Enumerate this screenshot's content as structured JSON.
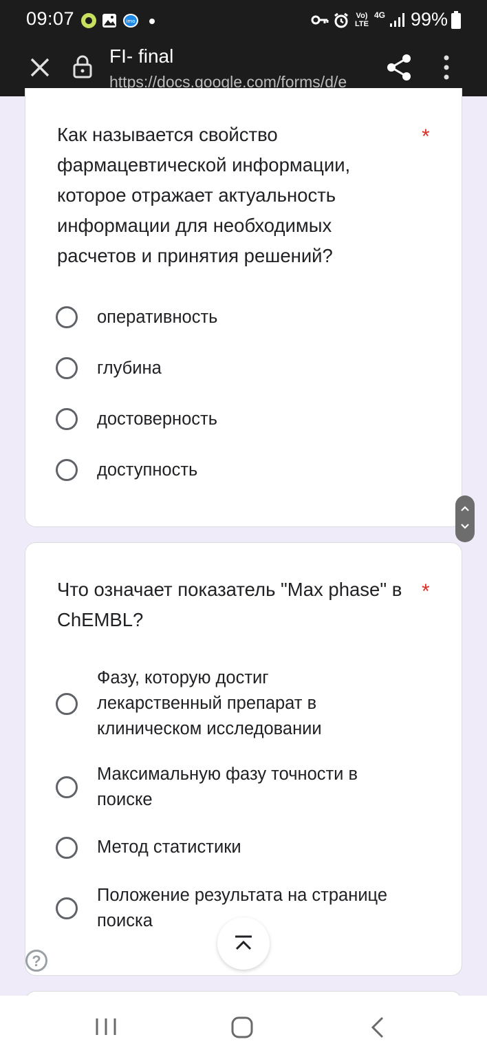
{
  "status_bar": {
    "time": "09:07",
    "battery": "99%",
    "network": "4G",
    "volte": "Vo) LTE",
    "icons": [
      "app-notification-icon",
      "gallery-icon",
      "imo-icon",
      "dot-icon",
      "vpn-key-icon",
      "alarm-icon",
      "signal-icon",
      "battery-icon"
    ]
  },
  "toolbar": {
    "title": "FI- final",
    "url": "https://docs.google.com/forms/d/e",
    "icons": [
      "close-icon",
      "lock-icon",
      "share-icon",
      "more-vert-icon"
    ]
  },
  "questions": [
    {
      "text": "Как называется свойство фармацевтической информации, которое отражает актуальность информации для необходимых расчетов и принятия решений?",
      "required_mark": "*",
      "options": [
        "оперативность",
        "глубина",
        "достоверность",
        "доступность"
      ]
    },
    {
      "text": "Что означает показатель \"Max phase\" в ChEMBL?",
      "required_mark": "*",
      "options": [
        "Фазу, которую достиг лекарственный препарат в клиническом исследовании",
        "Максимальную фазу точности в поиске",
        "Метод статистики",
        "Положение результата на странице поиска"
      ]
    }
  ],
  "help_label": "?",
  "colors": {
    "background": "#efebf8",
    "card": "#ffffff",
    "required": "#d93025",
    "bars": "#1c1c1c"
  }
}
